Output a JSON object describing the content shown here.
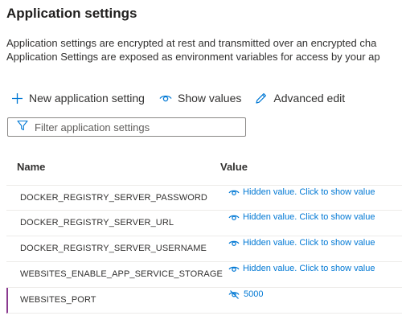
{
  "page": {
    "title": "Application settings",
    "description_lines": [
      "Application settings are encrypted at rest and transmitted over an encrypted cha",
      "Application Settings are exposed as environment variables for access by your ap"
    ]
  },
  "toolbar": {
    "new_label": "New application setting",
    "show_values_label": "Show values",
    "advanced_edit_label": "Advanced edit"
  },
  "filter": {
    "placeholder": "Filter application settings",
    "value": ""
  },
  "table": {
    "headers": {
      "name": "Name",
      "value": "Value"
    },
    "rows": [
      {
        "name": "DOCKER_REGISTRY_SERVER_PASSWORD",
        "value": "Hidden value. Click to show value",
        "value_icon": "eye-icon"
      },
      {
        "name": "DOCKER_REGISTRY_SERVER_URL",
        "value": "Hidden value. Click to show value",
        "value_icon": "eye-icon"
      },
      {
        "name": "DOCKER_REGISTRY_SERVER_USERNAME",
        "value": "Hidden value. Click to show value",
        "value_icon": "eye-icon"
      },
      {
        "name": "WEBSITES_ENABLE_APP_SERVICE_STORAGE",
        "value": "Hidden value. Click to show value",
        "value_icon": "eye-icon"
      },
      {
        "name": "WEBSITES_PORT",
        "value": "5000",
        "value_icon": "eye-slash-icon",
        "selected": true
      }
    ]
  },
  "colors": {
    "accent": "#0078d4",
    "selection_marker": "#8a3a8f",
    "text": "#323130",
    "border": "#8a8886"
  }
}
